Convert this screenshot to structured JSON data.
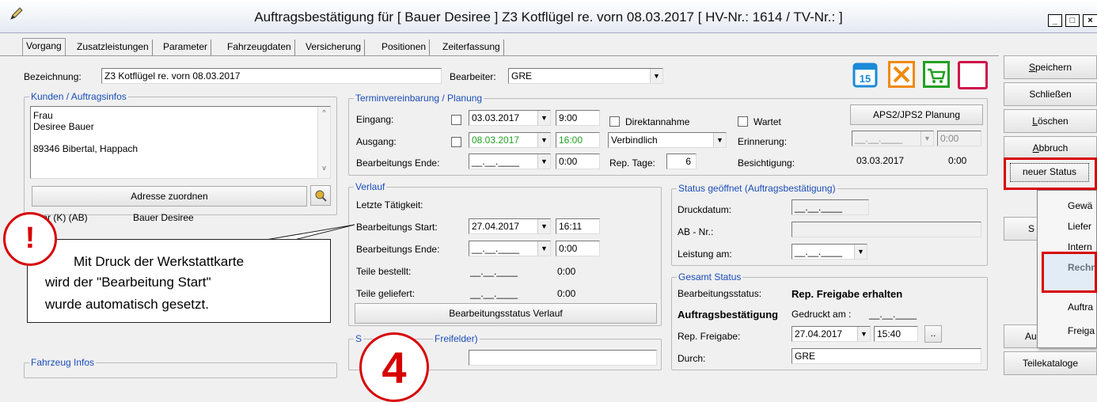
{
  "window": {
    "title": "Auftragsbestätigung  für [ Bauer Desiree ] Z3 Kotflügel re. vorn 08.03.2017 [ HV-Nr.: 1614 / TV-Nr.: ]",
    "icon": "pencil-icon",
    "minimize_label": "_",
    "maximize_label": "□",
    "close_label": "×"
  },
  "tabs": [
    {
      "label": "Vorgang",
      "active": true
    },
    {
      "label": "Zusatzleistungen"
    },
    {
      "label": "Parameter"
    },
    {
      "label": "Fahrzeugdaten"
    },
    {
      "label": "Versicherung"
    },
    {
      "label": "Positionen"
    },
    {
      "label": "Zeiterfassung"
    }
  ],
  "header": {
    "bezeichnung_label": "Bezeichnung:",
    "bezeichnung_value": "Z3 Kotflügel re. vorn 08.03.2017",
    "bearbeiter_label": "Bearbeiter:",
    "bearbeiter_value": "GRE",
    "toolbar_icons": [
      "calendar-icon",
      "orange-tool-icon",
      "cart-icon",
      "red-square-icon"
    ]
  },
  "kunden": {
    "title": "Kunden / Auftragsinfos",
    "address_lines": [
      "Frau",
      "Desiree Bauer",
      "",
      "89346 Bibertal, Happach"
    ],
    "assign_button": "Adresse zuordnen",
    "kunde_label": "...ter (K) (AB)",
    "kunde_value": "Bauer Desiree"
  },
  "termin": {
    "title": "Terminvereinbarung / Planung",
    "eingang_label": "Eingang:",
    "eingang_date": "03.03.2017",
    "eingang_time": "9:00",
    "ausgang_label": "Ausgang:",
    "ausgang_date": "08.03.2017",
    "ausgang_time": "16:00",
    "bearbeitungs_ende_label": "Bearbeitungs Ende:",
    "bearbeitungs_ende_date": "__.__.____",
    "bearbeitungs_ende_time": "0:00",
    "direktannahme_label": "Direktannahme",
    "wartet_label": "Wartet",
    "verbindlich_value": "Verbindlich",
    "erinnerung_label": "Erinnerung:",
    "erinnerung_date": "__.__.____",
    "erinnerung_time": "0:00",
    "rep_tage_label": "Rep. Tage:",
    "rep_tage_value": "6",
    "besichtigung_label": "Besichtigung:",
    "besichtigung_date": "03.03.2017",
    "besichtigung_time": "0:00",
    "aps_button": "APS2/JPS2 Planung"
  },
  "verlauf": {
    "title": "Verlauf",
    "letzte_label": "Letzte Tätigkeit:",
    "start_label": "Bearbeitungs Start:",
    "start_date": "27.04.2017",
    "start_time": "16:11",
    "ende_label": "Bearbeitungs Ende:",
    "ende_date": "__.__.____",
    "ende_time": "0:00",
    "teile_bestellt_label": "Teile bestellt:",
    "teile_bestellt_date": "__.__.____",
    "teile_bestellt_time": "0:00",
    "teile_geliefert_label": "Teile geliefert:",
    "teile_geliefert_date": "__.__.____",
    "teile_geliefert_time": "0:00",
    "status_button": "Bearbeitungsstatus Verlauf"
  },
  "status": {
    "title": "Status geöffnet (Auftragsbestätigung)",
    "druckdatum_label": "Druckdatum:",
    "druckdatum_value": "__.__.____",
    "abnr_label": "AB - Nr.:",
    "leistung_label": "Leistung am:",
    "leistung_value": "__.__.____"
  },
  "gesamt": {
    "title": "Gesamt Status",
    "bearbeitungsstatus_label": "Bearbeitungsstatus:",
    "bearbeitungsstatus_value": "Rep. Freigabe erhalten",
    "ab_label": "Auftragsbestätigung",
    "gedruckt_label": "Gedruckt am :",
    "gedruckt_value": "__.__.____",
    "freigabe_label": "Rep. Freigabe:",
    "freigabe_date": "27.04.2017",
    "freigabe_time": "15:40",
    "ellipsis": "..",
    "durch_label": "Durch:",
    "durch_value": "GRE"
  },
  "sonder": {
    "title_left": "S",
    "title_right": "Freifelder)"
  },
  "fahrzeug": {
    "title": "Fahrzeug Infos"
  },
  "side_buttons": [
    "Speichern",
    "Schließen",
    "Löschen",
    "Abbruch",
    "neuer Status",
    "S",
    "Au",
    "Teilekataloge"
  ],
  "side_hotkeys": [
    "S",
    "",
    "L",
    "A",
    "",
    "",
    "",
    ""
  ],
  "context_menu": [
    "Gewä",
    "Liefer",
    "Intern",
    "Rechn",
    "Auftra",
    "Freiga"
  ],
  "callout": {
    "badge": "!",
    "text_lines": [
      "Mit Druck der Werkstattkarte",
      "wird der \"Bearbeitung Start\"",
      "wurde automatisch gesetzt."
    ]
  },
  "step_badge": "4",
  "colors": {
    "accent_red": "#d80000",
    "group_title": "#1a4db8",
    "green_text": "#22a022"
  }
}
